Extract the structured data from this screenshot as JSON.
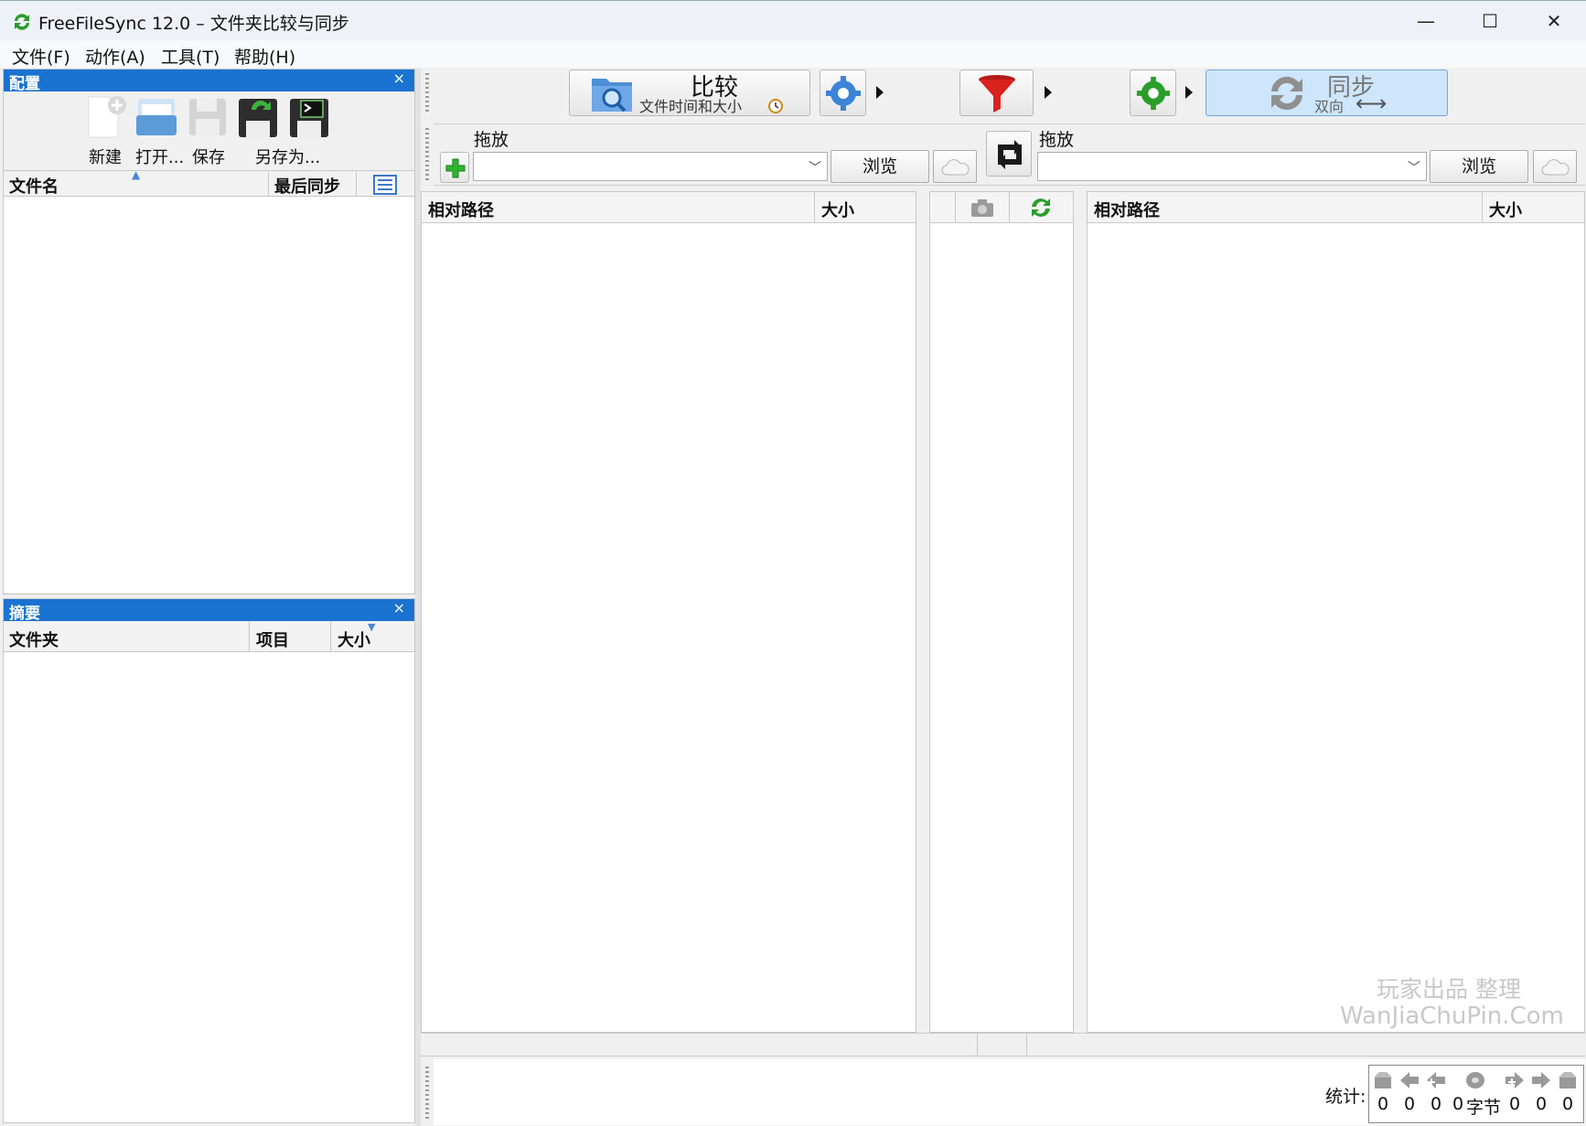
{
  "window": {
    "title": "FreeFileSync 12.0 – 文件夹比较与同步",
    "controls": {
      "minimize": "—",
      "maximize": "☐",
      "close": "✕"
    }
  },
  "menu": [
    "文件(F)",
    "动作(A)",
    "工具(T)",
    "帮助(H)"
  ],
  "config_panel": {
    "title": "配置",
    "close": "×",
    "buttons": [
      "新建",
      "打开...",
      "保存",
      "另存为..."
    ],
    "columns": {
      "name": "文件名",
      "last_sync": "最后同步"
    }
  },
  "summary_panel": {
    "title": "摘要",
    "close": "×",
    "columns": {
      "folder": "文件夹",
      "items": "项目",
      "size": "大小"
    }
  },
  "toolbar": {
    "compare": {
      "label": "比较",
      "sub": "文件时间和大小"
    },
    "sync": {
      "label": "同步",
      "sub": "双向"
    }
  },
  "folders": {
    "left": {
      "label": "拖放",
      "value": "",
      "browse": "浏览"
    },
    "right": {
      "label": "拖放",
      "value": "",
      "browse": "浏览"
    }
  },
  "grid": {
    "left": {
      "path": "相对路径",
      "size": "大小"
    },
    "right": {
      "path": "相对路径",
      "size": "大小"
    }
  },
  "watermark": {
    "line1": "玩家出品 整理",
    "line2": "WanJiaChuPin.Com"
  },
  "stats": {
    "label": "统计:",
    "values": [
      "0",
      "0",
      "0",
      "0",
      "0",
      "0",
      "0"
    ],
    "bytes_unit": "字节"
  },
  "colors": {
    "accent": "#1a73d1",
    "sync_bg": "#cde6fb",
    "filter": "#d9211e",
    "green": "#2a9d2a"
  }
}
